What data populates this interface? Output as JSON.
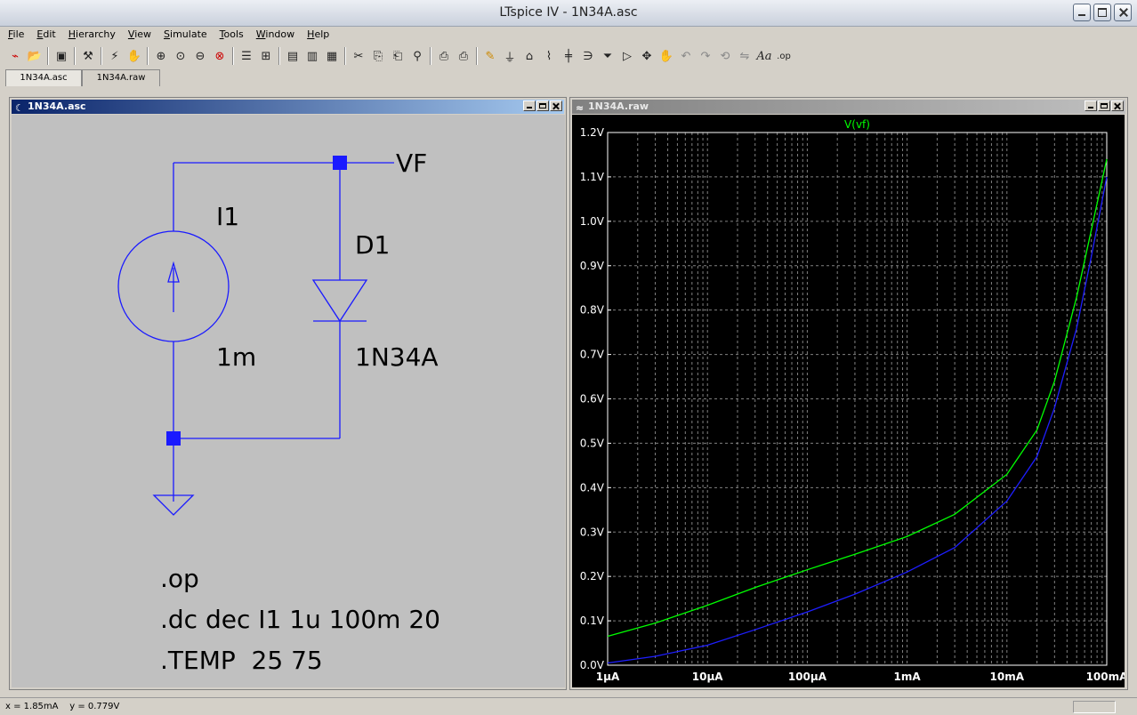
{
  "window": {
    "title": "LTspice IV - 1N34A.asc"
  },
  "menu": [
    {
      "label": "File",
      "key": "F",
      "rest": "ile"
    },
    {
      "label": "Edit",
      "key": "E",
      "rest": "dit"
    },
    {
      "label": "Hierarchy",
      "key": "H",
      "rest": "ierarchy"
    },
    {
      "label": "View",
      "key": "V",
      "rest": "iew"
    },
    {
      "label": "Simulate",
      "key": "S",
      "rest": "imulate"
    },
    {
      "label": "Tools",
      "key": "T",
      "rest": "ools"
    },
    {
      "label": "Window",
      "key": "W",
      "rest": "indow"
    },
    {
      "label": "Help",
      "key": "H",
      "rest": "elp"
    }
  ],
  "tabs": [
    "1N34A.asc",
    "1N34A.raw"
  ],
  "schematic": {
    "window_title": "1N34A.asc",
    "labels": {
      "net": "VF",
      "source_name": "I1",
      "source_value": "1m",
      "diode_name": "D1",
      "diode_model": "1N34A"
    },
    "directives": [
      ".op",
      ".dc dec I1 1u 100m 20",
      ".TEMP  25 75"
    ],
    "wire_color": "#1a1aff"
  },
  "plot": {
    "window_title": "1N34A.raw"
  },
  "chart_data": {
    "type": "line",
    "title": "V(vf)",
    "xlabel": "",
    "ylabel": "",
    "x_scale": "log",
    "xlim": [
      1e-06,
      0.1
    ],
    "ylim": [
      0.0,
      1.2
    ],
    "grid": true,
    "x_tick_labels": [
      "1µA",
      "10µA",
      "100µA",
      "1mA",
      "10mA",
      "100mA"
    ],
    "y_tick_labels": [
      "0.0V",
      "0.1V",
      "0.2V",
      "0.3V",
      "0.4V",
      "0.5V",
      "0.6V",
      "0.7V",
      "0.8V",
      "0.9V",
      "1.0V",
      "1.1V",
      "1.2V"
    ],
    "y_ticks": [
      0.0,
      0.1,
      0.2,
      0.3,
      0.4,
      0.5,
      0.6,
      0.7,
      0.8,
      0.9,
      1.0,
      1.1,
      1.2
    ],
    "series": [
      {
        "color": "#00ff00",
        "x": [
          1e-06,
          3e-06,
          1e-05,
          3e-05,
          0.0001,
          0.0003,
          0.001,
          0.003,
          0.01,
          0.02,
          0.03,
          0.05,
          0.07,
          0.1
        ],
        "y": [
          0.065,
          0.095,
          0.135,
          0.175,
          0.215,
          0.25,
          0.29,
          0.34,
          0.43,
          0.53,
          0.64,
          0.83,
          0.98,
          1.14
        ]
      },
      {
        "color": "#1e1eff",
        "x": [
          1e-06,
          3e-06,
          1e-05,
          3e-05,
          0.0001,
          0.0003,
          0.001,
          0.003,
          0.01,
          0.02,
          0.03,
          0.05,
          0.07,
          0.1
        ],
        "y": [
          0.005,
          0.02,
          0.045,
          0.08,
          0.12,
          0.16,
          0.21,
          0.265,
          0.37,
          0.47,
          0.58,
          0.76,
          0.92,
          1.1
        ]
      }
    ]
  },
  "status": {
    "cursor": "x = 1.85mA    y = 0.779V"
  }
}
